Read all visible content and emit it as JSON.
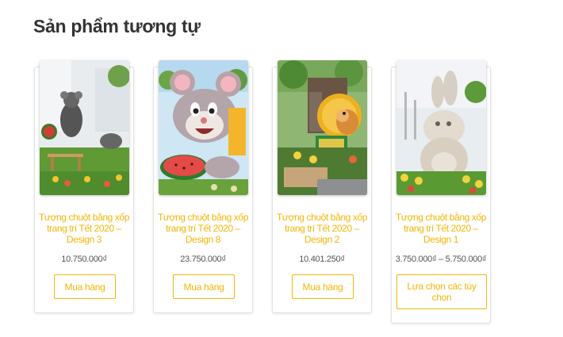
{
  "section": {
    "title": "Sản phẩm tương tự"
  },
  "products": [
    {
      "title": "Tượng chuột bằng xốp trang trí Tết 2020 – Design 3",
      "price": "10.750.000₫",
      "button": "Mua hàng"
    },
    {
      "title": "Tượng chuột bằng xốp trang trí Tết 2020 – Design 8",
      "price": "23.750.000₫",
      "button": "Mua hàng"
    },
    {
      "title": "Tượng chuột bằng xốp trang trí Tết 2020 – Design 2",
      "price": "10.401.250₫",
      "button": "Mua hàng"
    },
    {
      "title": "Tượng chuột bằng xốp trang trí Tết 2020 – Design 1",
      "price": "3.750.000₫ – 5.750.000₫",
      "button": "Lựa chọn các tùy chọn"
    }
  ],
  "colors": {
    "accent": "#f2b705",
    "title": "#333333",
    "price": "#555555"
  }
}
